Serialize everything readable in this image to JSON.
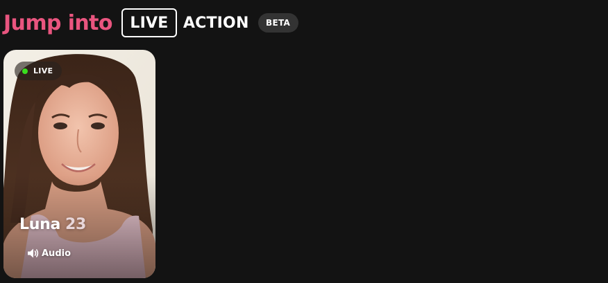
{
  "header": {
    "title": "Jump into",
    "live_label": "LIVE",
    "action_label": "ACTION",
    "beta_badge": "BETA"
  },
  "card": {
    "status_label": "LIVE",
    "name": "Luna",
    "age": "23",
    "audio_label": "Audio",
    "status_icon": "green-dot-icon",
    "audio_icon": "speaker-icon"
  },
  "colors": {
    "background": "#131313",
    "accent_pink": "#e9557f",
    "live_green": "#3ade1f",
    "badge_bg": "#333333"
  }
}
